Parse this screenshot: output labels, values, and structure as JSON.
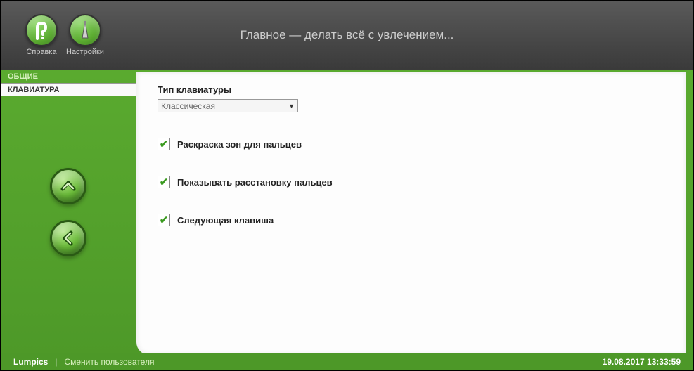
{
  "header": {
    "title": "Главное — делать всё с увлечением...",
    "icons": {
      "help": "Справка",
      "settings": "Настройки"
    }
  },
  "sidebar": {
    "tabs": {
      "general": "ОБЩИЕ",
      "keyboard": "КЛАВИАТУРА"
    }
  },
  "content": {
    "section_title": "Тип клавиатуры",
    "dropdown_value": "Классическая",
    "checkbox1": "Раскраска зон для пальцев",
    "checkbox2": "Показывать расстановку пальцев",
    "checkbox3": "Следующая клавиша"
  },
  "footer": {
    "user": "Lumpics",
    "change_user": "Сменить пользователя",
    "datetime": "19.08.2017 13:33:59"
  }
}
